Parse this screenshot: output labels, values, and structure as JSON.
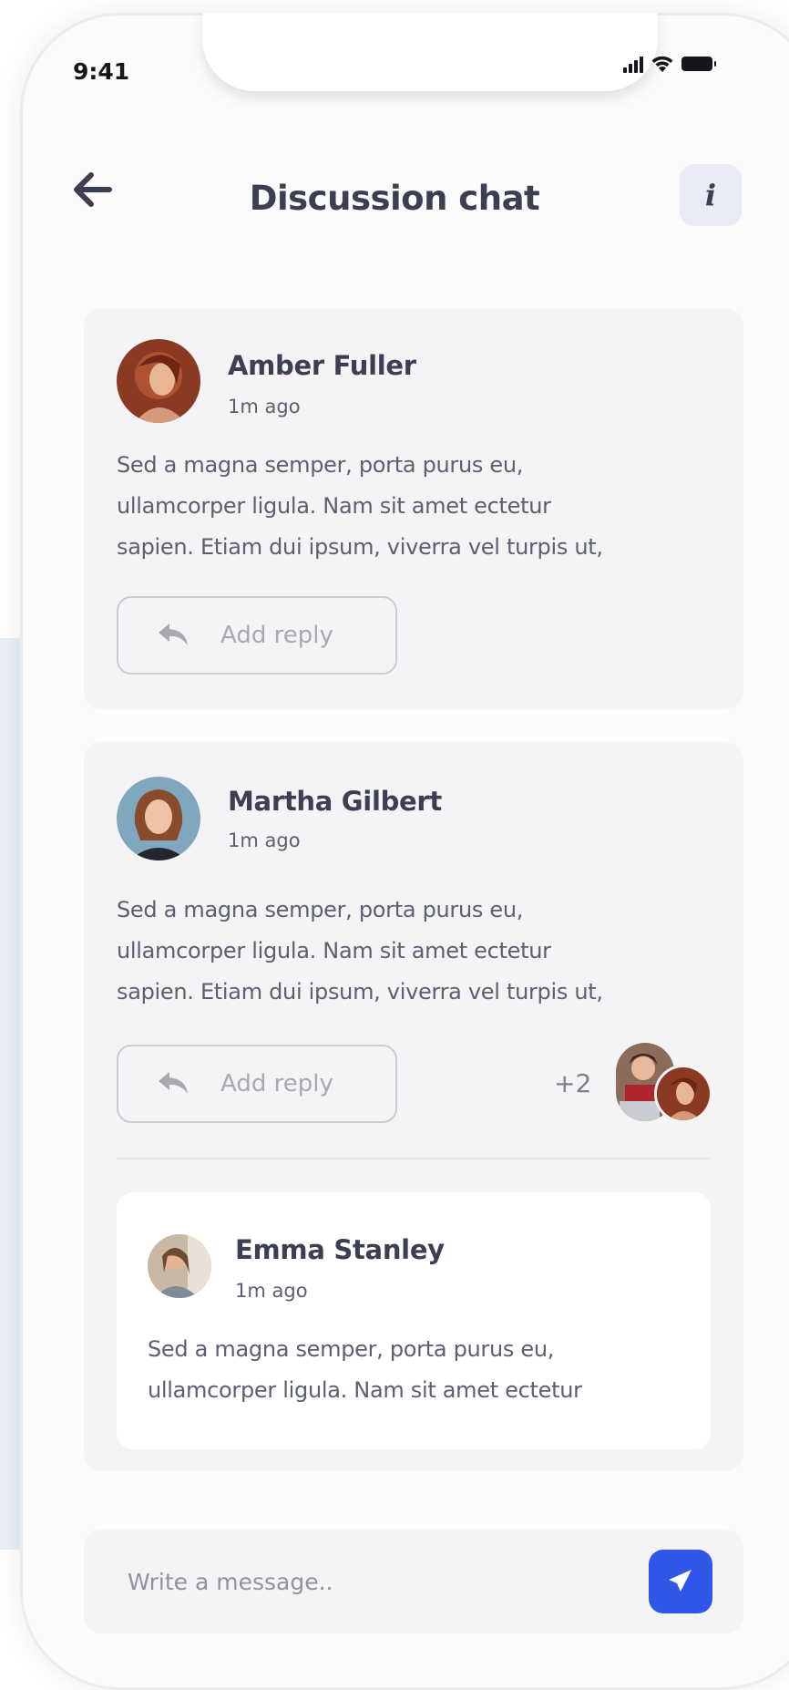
{
  "status_bar": {
    "time": "9:41"
  },
  "header": {
    "title": "Discussion chat",
    "back_icon": "arrow-left-icon",
    "info_icon": "info-icon"
  },
  "comments": [
    {
      "author": "Amber Fuller",
      "time": "1m ago",
      "lines": [
        "Sed a magna semper, porta purus eu,",
        "ullamcorper ligula. Nam sit amet ectetur",
        "sapien. Etiam dui ipsum, viverra vel turpis ut,"
      ],
      "reply_label": "Add reply"
    },
    {
      "author": "Martha Gilbert",
      "time": "1m ago",
      "lines": [
        "Sed a magna semper, porta purus eu,",
        "ullamcorper ligula. Nam sit amet ectetur",
        "sapien. Etiam dui ipsum, viverra vel turpis ut,"
      ],
      "reply_label": "Add reply",
      "participants_more": "+2",
      "reply": {
        "author": "Emma Stanley",
        "time": "1m ago",
        "lines": [
          "Sed a magna semper, porta purus eu,",
          "ullamcorper ligula. Nam sit amet ectetur"
        ]
      }
    }
  ],
  "composer": {
    "placeholder": "Write a message..",
    "send_icon": "send-icon"
  },
  "colors": {
    "accent": "#2f56e6",
    "title_text": "#3b3f51",
    "card_bg": "#f4f4f6"
  }
}
